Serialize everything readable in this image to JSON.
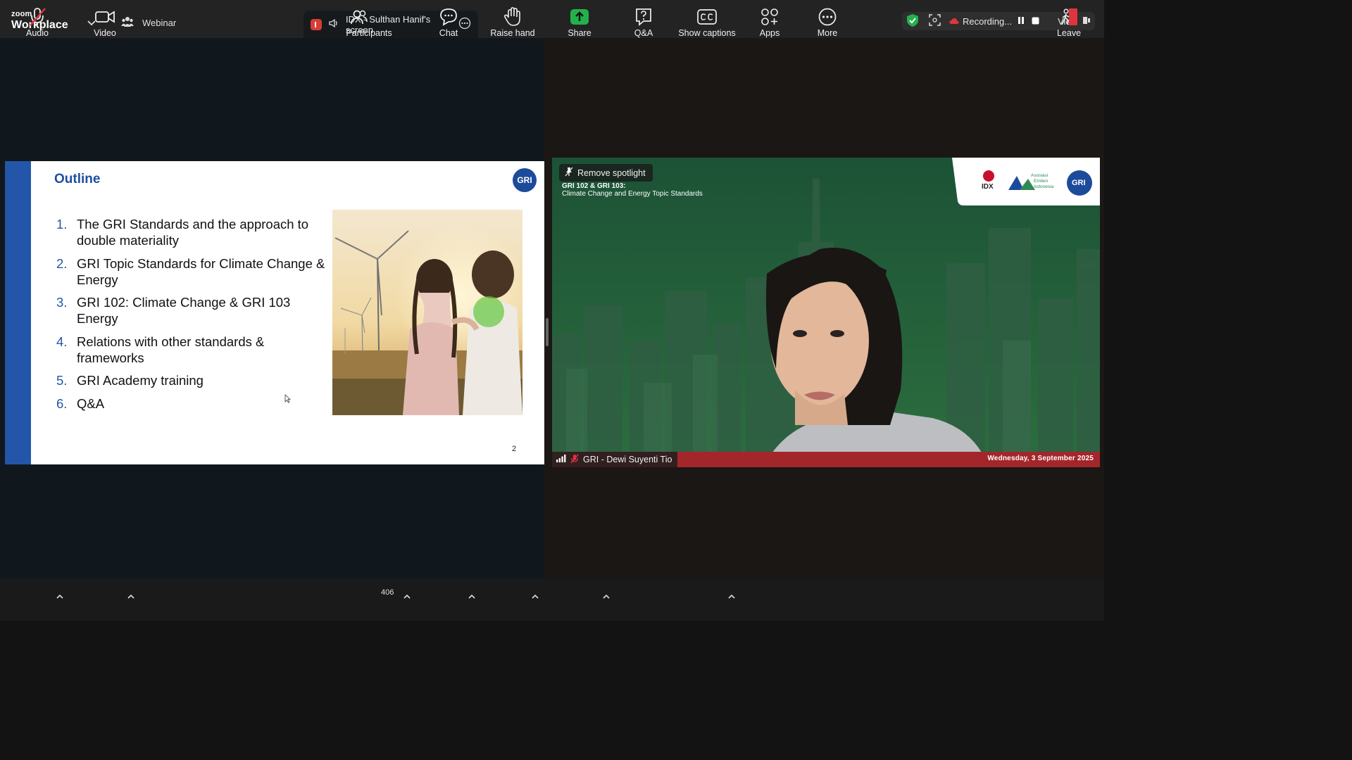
{
  "app": {
    "logo_small": "zoom",
    "logo_big": "Workplace"
  },
  "header": {
    "webinar_label": "Webinar",
    "share_tab_label": "IDX - Sulthan Hanif's screen",
    "recording_label": "Recording...",
    "view_label": "View"
  },
  "slide": {
    "title": "Outline",
    "logo_text": "GRI",
    "items": [
      {
        "num": "1.",
        "text": "The GRI Standards and the approach to double materiality"
      },
      {
        "num": "2.",
        "text": "GRI Topic Standards for Climate Change & Energy"
      },
      {
        "num": "3.",
        "text": "GRI 102: Climate Change & GRI 103 Energy"
      },
      {
        "num": "4.",
        "text": "Relations with other standards & frameworks"
      },
      {
        "num": "5.",
        "text": "GRI Academy training"
      },
      {
        "num": "6.",
        "text": "Q&A"
      }
    ],
    "page_number": "2"
  },
  "video": {
    "spotlight_label": "Remove spotlight",
    "banner_line1": "GRI 102 & GRI 103:",
    "banner_line2": "Climate Change and Energy Topic Standards",
    "participant_name": "GRI - Dewi Suyenti Tio",
    "date_text": "Wednesday, 3 September 2025",
    "logos": {
      "idx": "IDX",
      "aei_1": "Asosiasi",
      "aei_2": "Emiten",
      "aei_3": "Indonesia",
      "gri": "GRI"
    }
  },
  "toolbar": {
    "audio": "Audio",
    "video": "Video",
    "participants": "Participants",
    "participants_count": "406",
    "chat": "Chat",
    "raise_hand": "Raise hand",
    "share": "Share",
    "qa": "Q&A",
    "captions": "Show captions",
    "apps": "Apps",
    "more": "More",
    "leave": "Leave"
  },
  "colors": {
    "toolbar_bg": "#1a1a1a",
    "topbar_bg": "#232323",
    "slide_accent": "#2356a8",
    "share_green": "#22b14c",
    "leave_red": "#e0343c",
    "lower_bar_red": "#a3262b"
  }
}
